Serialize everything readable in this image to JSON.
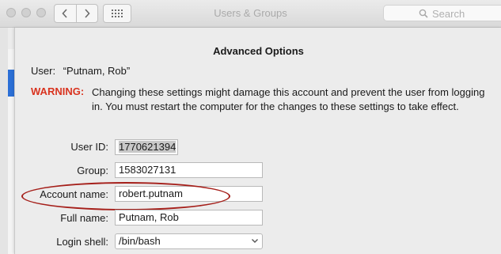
{
  "window": {
    "title": "Users & Groups",
    "search_placeholder": "Search"
  },
  "sheet": {
    "title": "Advanced Options",
    "user_label": "User:",
    "user_value": "“Putnam, Rob”",
    "warning_label": "WARNING:",
    "warning_text": "Changing these settings might damage this account and prevent the user from logging in. You must restart the computer for the changes to these settings to take effect."
  },
  "fields": {
    "user_id": {
      "label": "User ID:",
      "value": "1770621394"
    },
    "group": {
      "label": "Group:",
      "value": "1583027131"
    },
    "account_name": {
      "label": "Account name:",
      "value": "robert.putnam"
    },
    "full_name": {
      "label": "Full name:",
      "value": "Putnam, Rob"
    },
    "login_shell": {
      "label": "Login shell:",
      "value": "/bin/bash"
    }
  },
  "colors": {
    "warning": "#d9331f",
    "highlight_oval": "#a51f1a",
    "selection": "#2b6fd6"
  },
  "icons": {
    "back": "chevron-left-icon",
    "forward": "chevron-right-icon",
    "show_all": "grid-icon",
    "search": "search-icon",
    "select": "chevron-down-icon"
  }
}
